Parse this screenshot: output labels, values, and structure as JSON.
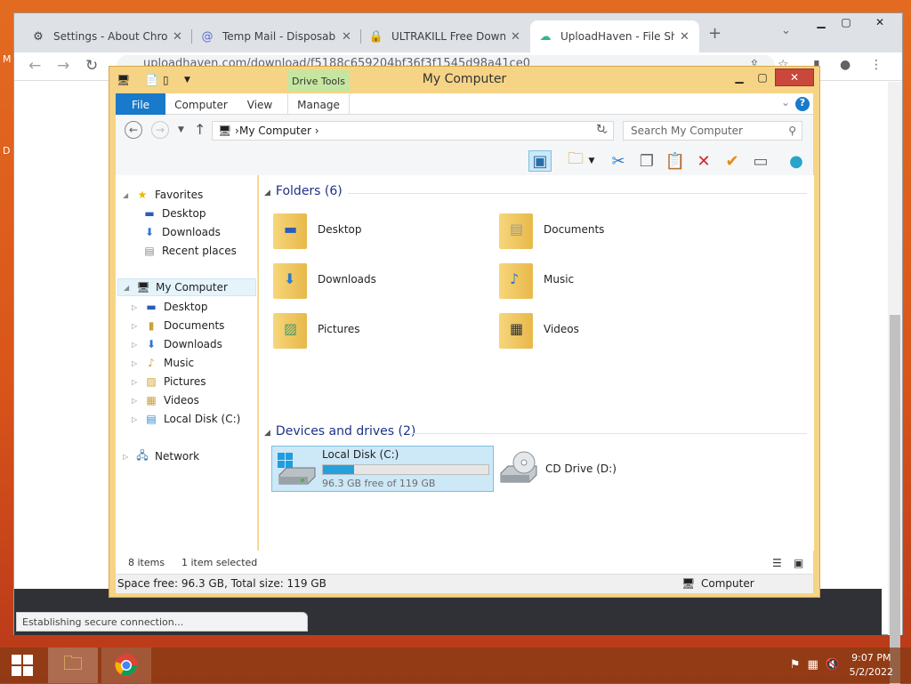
{
  "desktop": {
    "left_text": [
      "M",
      "D"
    ]
  },
  "chrome": {
    "tabs": [
      {
        "title": "Settings - About Chrome",
        "icon": "gear-icon"
      },
      {
        "title": "Temp Mail - Disposable",
        "icon": "at-icon"
      },
      {
        "title": "ULTRAKILL Free Download",
        "icon": "lock-icon"
      },
      {
        "title": "UploadHaven - File Sha",
        "icon": "upload-icon",
        "active": true
      }
    ],
    "url": "uploadhaven.com/download/f5188c659204bf36f3f1545d98a41ce0",
    "status": "Establishing secure connection..."
  },
  "explorer": {
    "title": "My Computer",
    "context_tab": "Drive Tools",
    "ribbon_tabs": [
      "File",
      "Computer",
      "View",
      "Manage"
    ],
    "address": "My Computer",
    "search_placeholder": "Search My Computer",
    "nav": {
      "favorites": {
        "label": "Favorites",
        "items": [
          "Desktop",
          "Downloads",
          "Recent places"
        ]
      },
      "computer": {
        "label": "My Computer",
        "items": [
          "Desktop",
          "Documents",
          "Downloads",
          "Music",
          "Pictures",
          "Videos",
          "Local Disk (C:)"
        ]
      },
      "network": "Network"
    },
    "folders_header": "Folders (6)",
    "folders": [
      "Desktop",
      "Documents",
      "Downloads",
      "Music",
      "Pictures",
      "Videos"
    ],
    "drives_header": "Devices and drives (2)",
    "drives": [
      {
        "name": "Local Disk (C:)",
        "free": "96.3 GB free of 119 GB",
        "used_fraction": 0.19
      },
      {
        "name": "CD Drive (D:)"
      }
    ],
    "status": {
      "items": "8 items",
      "selected": "1 item selected"
    },
    "footer": {
      "space": "Space free: 96.3 GB, Total size: 119 GB",
      "location": "Computer"
    }
  },
  "taskbar": {
    "time": "9:07 PM",
    "date": "5/2/2022"
  }
}
